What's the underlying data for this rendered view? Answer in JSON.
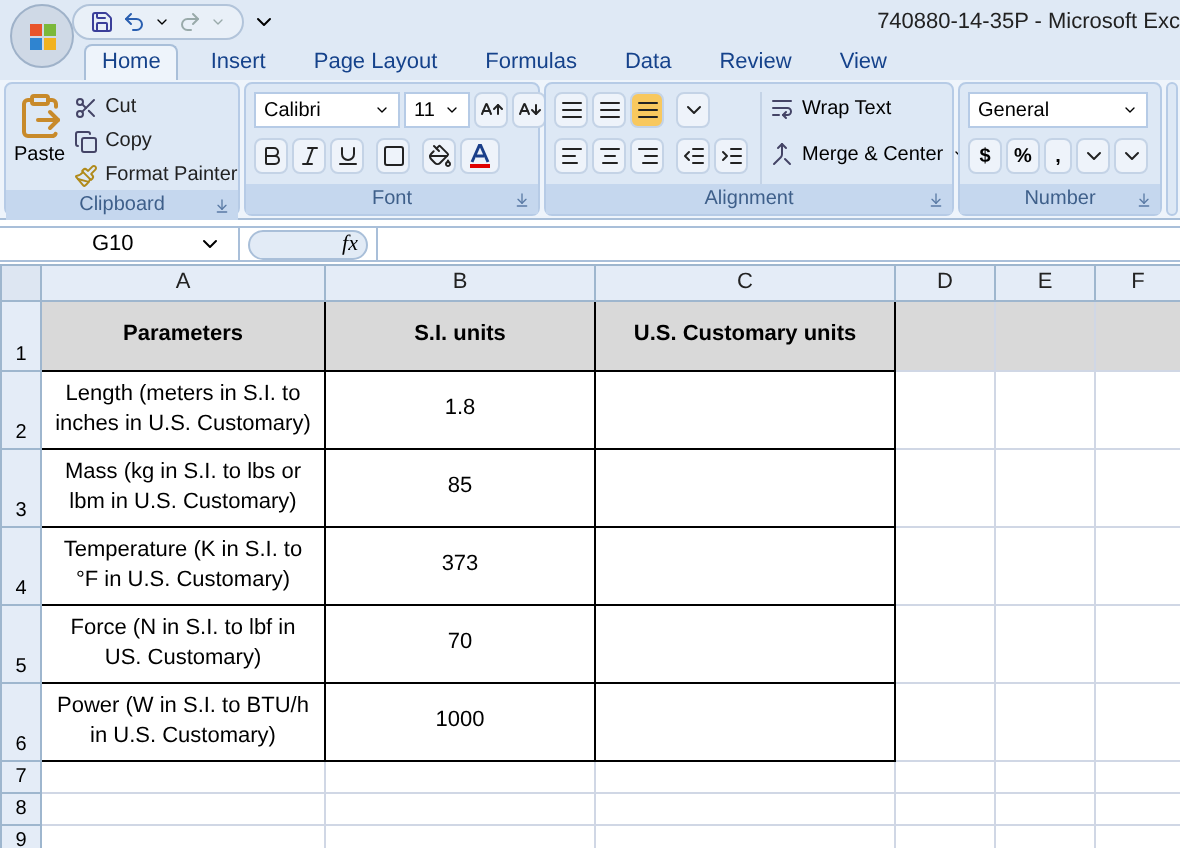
{
  "window": {
    "title": "740880-14-35P - Microsoft Exc"
  },
  "tabs": [
    {
      "label": "Home",
      "selected": true
    },
    {
      "label": "Insert",
      "selected": false
    },
    {
      "label": "Page Layout",
      "selected": false
    },
    {
      "label": "Formulas",
      "selected": false
    },
    {
      "label": "Data",
      "selected": false
    },
    {
      "label": "Review",
      "selected": false
    },
    {
      "label": "View",
      "selected": false
    }
  ],
  "clipboard": {
    "label": "Clipboard",
    "paste": "Paste",
    "cut": "Cut",
    "copy": "Copy",
    "format_painter": "Format Painter"
  },
  "font": {
    "label": "Font",
    "family": "Calibri",
    "size": "11"
  },
  "alignment": {
    "label": "Alignment",
    "wrap_text": "Wrap Text",
    "merge_center": "Merge & Center"
  },
  "number": {
    "label": "Number",
    "format": "General",
    "currency": "$",
    "percent": "%",
    "comma": ","
  },
  "formula_bar": {
    "name_box": "G10",
    "fx": "fx"
  },
  "columns": [
    "A",
    "B",
    "C",
    "D",
    "E",
    "F"
  ],
  "rows": [
    {
      "number": "1",
      "kind": "header",
      "cells": [
        "Parameters",
        "S.I. units",
        "U.S. Customary units"
      ]
    },
    {
      "number": "2",
      "kind": "data",
      "cells": [
        "Length (meters in S.I. to inches in U.S. Customary)",
        "1.8",
        ""
      ]
    },
    {
      "number": "3",
      "kind": "data",
      "cells": [
        "Mass (kg in S.I. to lbs or lbm in U.S. Customary)",
        "85",
        ""
      ]
    },
    {
      "number": "4",
      "kind": "data",
      "cells": [
        "Temperature (K in S.I. to °F in U.S. Customary)",
        "373",
        ""
      ]
    },
    {
      "number": "5",
      "kind": "data",
      "cells": [
        "Force (N in S.I. to lbf in US. Customary)",
        "70",
        ""
      ]
    },
    {
      "number": "6",
      "kind": "data",
      "cells": [
        "Power (W in S.I. to BTU/h in U.S. Customary)",
        "1000",
        ""
      ]
    },
    {
      "number": "7",
      "kind": "empty",
      "cells": []
    },
    {
      "number": "8",
      "kind": "empty",
      "cells": []
    },
    {
      "number": "9",
      "kind": "empty",
      "cells": []
    }
  ]
}
